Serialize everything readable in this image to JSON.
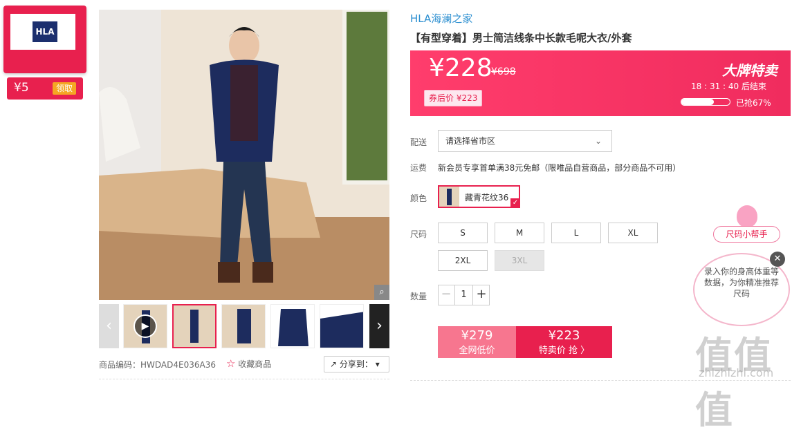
{
  "store": {
    "logo_text": "HLA",
    "coupon_amount": "¥5",
    "coupon_claim": "领取"
  },
  "product": {
    "brand": "HLA海澜之家",
    "title": "【有型穿着】男士简洁线条中长款毛呢大衣/外套",
    "sku_label": "商品编码：HWDAD4E036A36",
    "favorite_label": "收藏商品",
    "share_label": "分享到："
  },
  "price": {
    "current": "¥228",
    "original": "¥698",
    "coupon_price": "券后价 ¥223",
    "sale_title": "大牌特卖",
    "countdown": "18 : 31 : 40  后结束",
    "progress_label": "已抢67%",
    "progress_value": 0.67
  },
  "delivery": {
    "label": "配送",
    "select_value": "请选择省市区"
  },
  "shipping": {
    "label": "运费",
    "text": "新会员专享首单满38元免邮（限唯品自营商品，部分商品不可用）"
  },
  "color": {
    "label": "颜色",
    "option": "藏青花纹36"
  },
  "size": {
    "label": "尺码",
    "options": [
      "S",
      "M",
      "L",
      "XL",
      "2XL",
      "3XL"
    ]
  },
  "quantity": {
    "label": "数量",
    "value": "1",
    "minus": "−",
    "plus": "+"
  },
  "buy": {
    "left_price": "¥279",
    "left_label": "全网低价",
    "right_price": "¥223",
    "right_label": "特卖价 抢 〉"
  },
  "size_helper": {
    "tag": "尺码小帮手",
    "text": "录入你的身高体重等数据，为你精准推荐尺码"
  },
  "watermark": {
    "text": "值值值",
    "url": "zhizhizhi.com"
  },
  "colors": {
    "accent": "#e8204e",
    "link": "#2a8ed0"
  }
}
